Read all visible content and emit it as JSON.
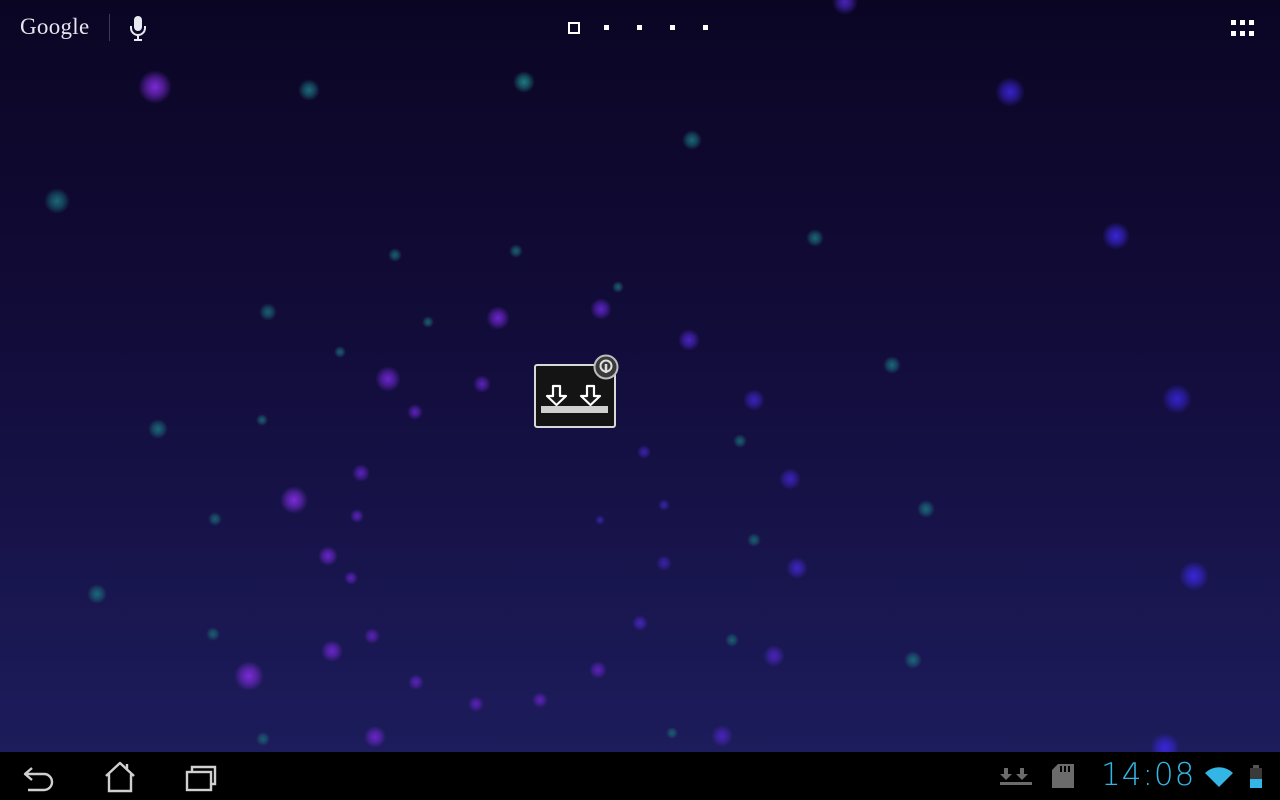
{
  "search_bar": {
    "logo_text": "Google",
    "logo_icon": "google-wordmark",
    "voice_search_icon": "microphone-icon"
  },
  "home_screen": {
    "page_count": 5,
    "current_page": 1,
    "all_apps_icon": "grid-icon"
  },
  "shortcut": {
    "icon": "download-app-icon",
    "badge_icon": "usb-debug-badge-icon",
    "label": ""
  },
  "navigation": {
    "back_icon": "back-arrow-icon",
    "home_icon": "home-icon",
    "recents_icon": "recent-apps-icon"
  },
  "status": {
    "notification_icons": [
      "download-icon",
      "sd-card-icon"
    ],
    "time": "14:08",
    "wifi_icon": "wifi-icon",
    "battery_icon": "battery-icon",
    "clock_color": "#33b5e5"
  },
  "colors": {
    "wallpaper_top": "#0b0524",
    "wallpaper_bottom": "#1d1c5c",
    "accent": "#33b5e5"
  }
}
